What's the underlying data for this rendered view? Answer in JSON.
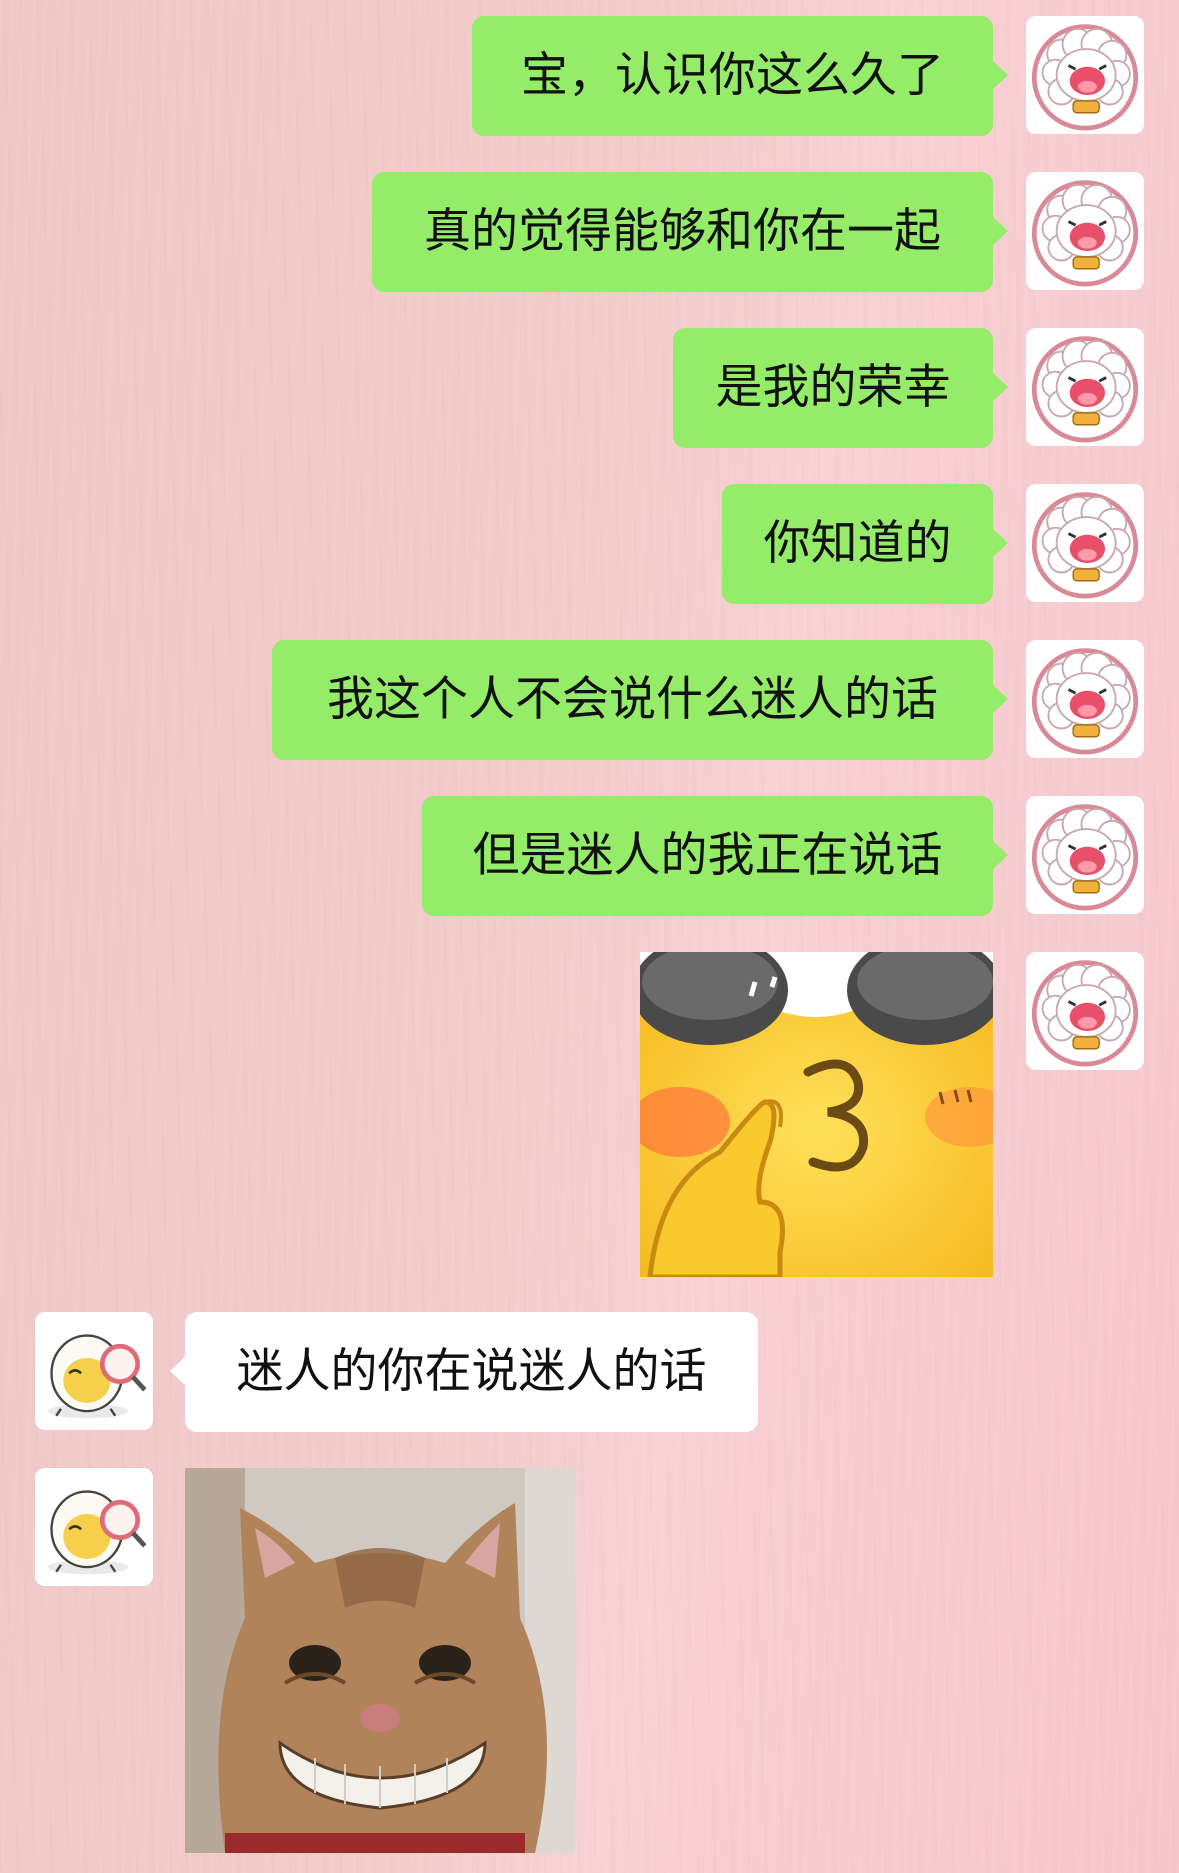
{
  "chat": {
    "sent_messages": [
      {
        "type": "text",
        "text": "宝，认识你这么久了"
      },
      {
        "type": "text",
        "text": "真的觉得能够和你在一起"
      },
      {
        "type": "text",
        "text": "是我的荣幸"
      },
      {
        "type": "text",
        "text": "你知道的"
      },
      {
        "type": "text",
        "text": "我这个人不会说什么迷人的话"
      },
      {
        "type": "text",
        "text": "但是迷人的我正在说话"
      },
      {
        "type": "sticker",
        "sticker": "yellow-duck-thumbs-up-sticker"
      }
    ],
    "received_messages": [
      {
        "type": "text",
        "text": "迷人的你在说迷人的话"
      },
      {
        "type": "sticker",
        "sticker": "grinning-cat-sticker"
      }
    ],
    "self_avatar": "sheep-avatar-icon",
    "contact_avatar": "egg-magnifier-avatar-icon",
    "colors": {
      "sent_bubble": "#95ec69",
      "received_bubble": "#ffffff",
      "background": "#f3cbcb"
    }
  }
}
